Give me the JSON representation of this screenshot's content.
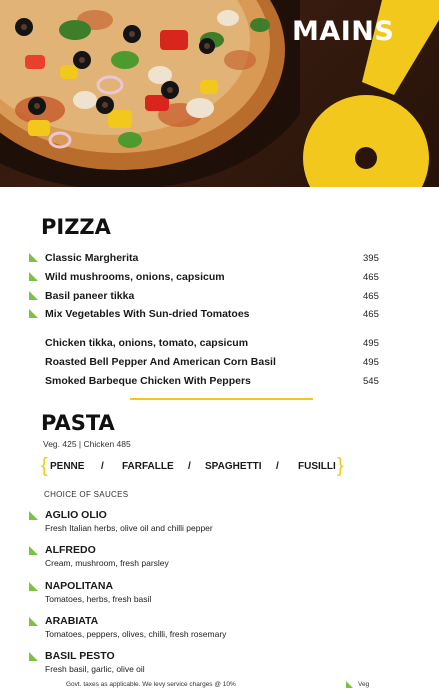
{
  "header": {
    "title": "MAINS"
  },
  "pizza": {
    "title": "PIZZA",
    "items": [
      {
        "name": "Classic Margherita",
        "price": "395",
        "veg": true
      },
      {
        "name": "Wild mushrooms, onions, capsicum",
        "price": "465",
        "veg": true
      },
      {
        "name": "Basil paneer tikka",
        "price": "465",
        "veg": true
      },
      {
        "name": "Mix Vegetables With Sun-dried Tomatoes",
        "price": "465",
        "veg": true
      },
      {
        "name": "Chicken tikka, onions, tomato, capsicum",
        "price": "495",
        "veg": false
      },
      {
        "name": "Roasted Bell Pepper And American Corn Basil",
        "price": "495",
        "veg": false
      },
      {
        "name": "Smoked Barbeque Chicken With Peppers",
        "price": "545",
        "veg": false
      }
    ]
  },
  "pasta": {
    "title": "PASTA",
    "prices": "Veg.  425   |   Chicken  485",
    "types": [
      "PENNE",
      "FARFALLE",
      "SPAGHETTI",
      "FUSILLI"
    ],
    "separator": "/",
    "sauce_heading": "CHOICE OF SAUCES",
    "sauces": [
      {
        "name": "AGLIO OLIO",
        "desc": "Fresh Italian herbs, olive oil and chilli pepper"
      },
      {
        "name": "ALFREDO",
        "desc": "Cream, mushroom, fresh parsley"
      },
      {
        "name": "NAPOLITANA",
        "desc": "Tomatoes, herbs, fresh basil"
      },
      {
        "name": "ARABIATA",
        "desc": "Tomatoes, peppers, olives, chilli, fresh rosemary"
      },
      {
        "name": "BASIL PESTO",
        "desc": "Fresh basil, garlic, olive oil"
      }
    ]
  },
  "footer": {
    "note": "Govt. taxes as applicable. We levy service charges @ 10%",
    "legend_label": "Veg"
  },
  "colors": {
    "accent_yellow": "#f2c81d",
    "veg_green": "#7dc142",
    "wood_dark": "#2a140b"
  }
}
